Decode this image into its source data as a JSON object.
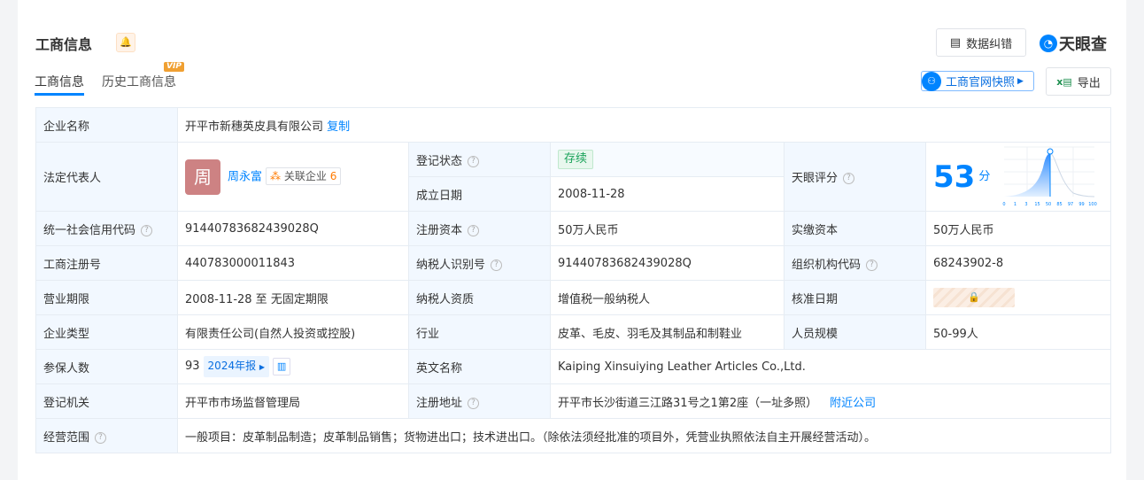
{
  "header": {
    "title": "工商信息",
    "tabs": [
      "工商信息",
      "历史工商信息"
    ],
    "vip": "VIP",
    "feedback": "数据纠错",
    "logo": "天眼查",
    "snapshot": "工商官网快照",
    "export": "导出"
  },
  "rows": {
    "company_name_label": "企业名称",
    "company_name": "开平市新穗英皮具有限公司",
    "copy": "复制",
    "legal_rep_label": "法定代表人",
    "legal_rep_avatar": "周",
    "legal_rep": "周永富",
    "related_label": "关联企业",
    "related_count": "6",
    "status_label": "登记状态",
    "status": "存续",
    "founded_label": "成立日期",
    "founded": "2008-11-28",
    "score_label": "天眼评分",
    "score": "53",
    "score_unit": "分",
    "score_ticks": [
      "0",
      "1",
      "3",
      "15",
      "50",
      "85",
      "97",
      "99",
      "100"
    ],
    "credit_code_label": "统一社会信用代码",
    "credit_code": "91440783682439028Q",
    "reg_capital_label": "注册资本",
    "reg_capital": "50万人民币",
    "paid_capital_label": "实缴资本",
    "paid_capital": "50万人民币",
    "reg_no_label": "工商注册号",
    "reg_no": "440783000011843",
    "taxpayer_id_label": "纳税人识别号",
    "taxpayer_id": "91440783682439028Q",
    "org_code_label": "组织机构代码",
    "org_code": "68243902-8",
    "term_label": "营业期限",
    "term": "2008-11-28 至 无固定期限",
    "taxpayer_type_label": "纳税人资质",
    "taxpayer_type": "增值税一般纳税人",
    "approved_label": "核准日期",
    "company_type_label": "企业类型",
    "company_type": "有限责任公司(自然人投资或控股)",
    "industry_label": "行业",
    "industry": "皮革、毛皮、羽毛及其制品和制鞋业",
    "staff_label": "人员规模",
    "staff": "50-99人",
    "insured_label": "参保人数",
    "insured": "93",
    "report": "2024年报",
    "english_label": "英文名称",
    "english": "Kaiping Xinsuiying Leather Articles Co.,Ltd.",
    "authority_label": "登记机关",
    "authority": "开平市市场监督管理局",
    "address_label": "注册地址",
    "address": "开平市长沙街道三江路31号之1第2座（一址多照）",
    "nearby": "附近公司",
    "scope_label": "经营范围",
    "scope": "一般项目：皮革制品制造；皮革制品销售；货物进出口；技术进出口。（除依法须经批准的项目外，凭营业执照依法自主开展经营活动）。"
  }
}
